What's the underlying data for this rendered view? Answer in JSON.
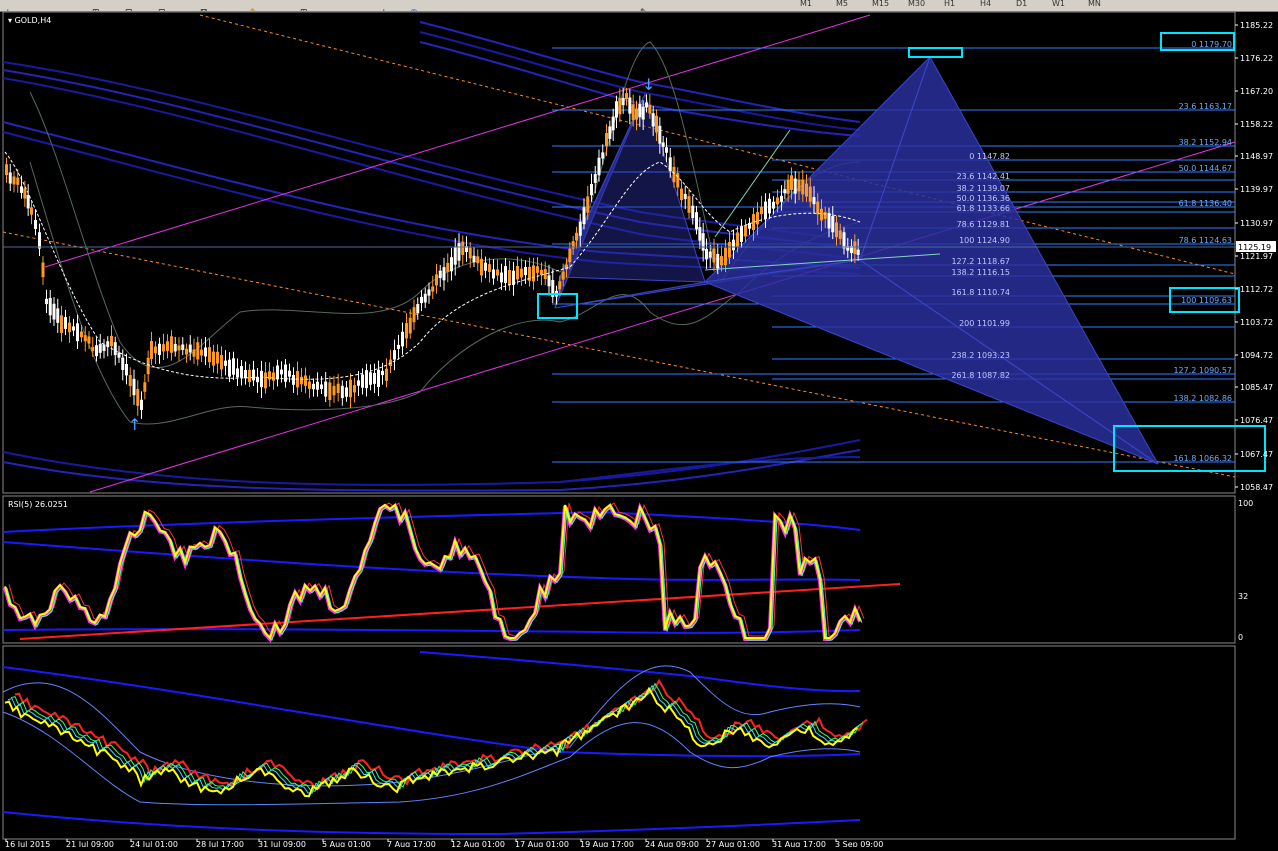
{
  "toolbar": {
    "icons": [
      "add-icon",
      "folder-icon",
      "arrow-icon",
      "zoom-icon",
      "cursor-icon",
      "hand-icon",
      "crosshair-icon",
      "line-icon",
      "plus-icon",
      "refresh-icon",
      "pencil-icon"
    ],
    "timeframes": [
      "M1",
      "M5",
      "M15",
      "M30",
      "H1",
      "H4",
      "D1",
      "W1",
      "MN"
    ]
  },
  "main": {
    "title": "GOLD,H4",
    "current_price": "1125.19",
    "price_ticks": [
      "1185.22",
      "1176.22",
      "1167.20",
      "1158.22",
      "1148.97",
      "1139.97",
      "1130.97",
      "1121.97",
      "1112.72",
      "1103.72",
      "1094.72",
      "1085.47",
      "1076.47",
      "1067.47",
      "1058.47"
    ],
    "fib_left": [
      "0 1147.82",
      "23.6 1142.41",
      "38.2 1139.07",
      "50.0 1136.36",
      "61.8 1133.66",
      "78.6 1129.81",
      "100 1124.90",
      "127.2 1118.67",
      "138.2 1116.15",
      "161.8 1110.74",
      "200 1101.99",
      "238.2 1093.23",
      "261.8 1087.82"
    ],
    "fib_right": [
      "0 1179.70",
      "23.6 1163.17",
      "38.2 1152.94",
      "50.0 1144.67",
      "61.8 1136.40",
      "78.6 1124.63",
      "100 1109.63",
      "127.2 1090.57",
      "138.2 1082.86",
      "161.8 1066.32"
    ]
  },
  "rsi": {
    "title": "RSI(5) 26.0251",
    "levels": [
      "100",
      "32",
      "0"
    ]
  },
  "time_axis": {
    "labels": [
      "16 Jul 2015",
      "21 Jul 09:00",
      "24 Jul 01:00",
      "28 Jul 17:00",
      "31 Jul 09:00",
      "5 Aug 01:00",
      "7 Aug 17:00",
      "12 Aug 01:00",
      "17 Aug 01:00",
      "19 Aug 17:00",
      "24 Aug 09:00",
      "27 Aug 01:00",
      "31 Aug 17:00",
      "3 Sep 09:00"
    ]
  },
  "colors": {
    "background": "#000000",
    "bull_candle": "#ff9a1f",
    "bear_candle": "#ffffff",
    "fib_line": "#2f7fff",
    "pattern_fill": "#2a2f9c",
    "highlight_box": "#00e5ff",
    "channel": "#e633e6",
    "rsi_line": "#ffff00",
    "trend_red": "#ff2020"
  }
}
